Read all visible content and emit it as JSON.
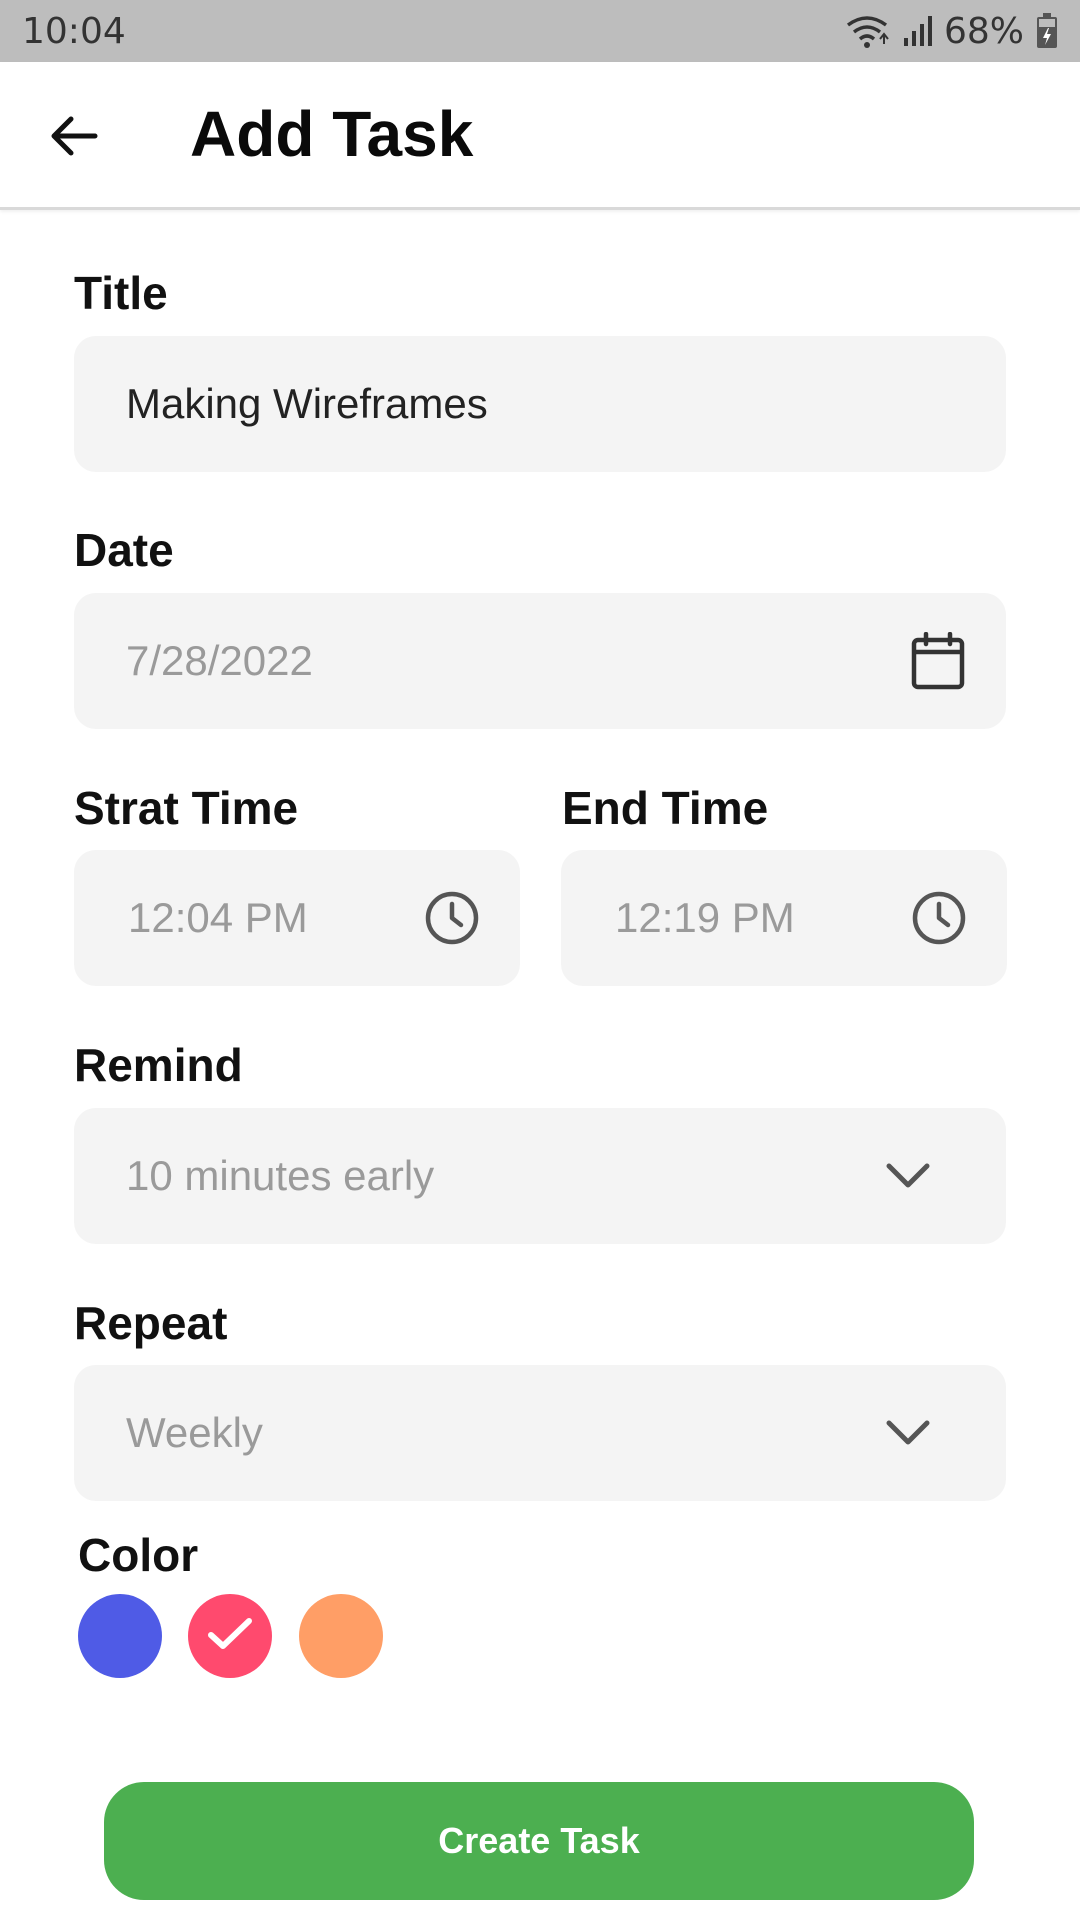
{
  "status_bar": {
    "time": "10:04",
    "battery_percent": "68%",
    "icons": [
      "wifi-icon",
      "signal-icon",
      "battery-icon"
    ]
  },
  "header": {
    "title": "Add Task",
    "back_icon": "arrow-left-icon"
  },
  "form": {
    "title": {
      "label": "Title",
      "value": "Making Wireframes"
    },
    "date": {
      "label": "Date",
      "value": "7/28/2022",
      "icon": "calendar-icon"
    },
    "start_time": {
      "label": "Strat Time",
      "value": "12:04 PM",
      "icon": "clock-icon"
    },
    "end_time": {
      "label": "End Time",
      "value": "12:19 PM",
      "icon": "clock-icon"
    },
    "remind": {
      "label": "Remind",
      "value": "10 minutes early",
      "icon": "chevron-down-icon"
    },
    "repeat": {
      "label": "Repeat",
      "value": "Weekly",
      "icon": "chevron-down-icon"
    },
    "color": {
      "label": "Color",
      "options": [
        {
          "name": "blue",
          "hex": "#4f5be6",
          "selected": false
        },
        {
          "name": "pink",
          "hex": "#ff4a6e",
          "selected": true
        },
        {
          "name": "orange",
          "hex": "#ff9e66",
          "selected": false
        }
      ]
    }
  },
  "actions": {
    "create_label": "Create Task",
    "create_color": "#4caf50"
  }
}
